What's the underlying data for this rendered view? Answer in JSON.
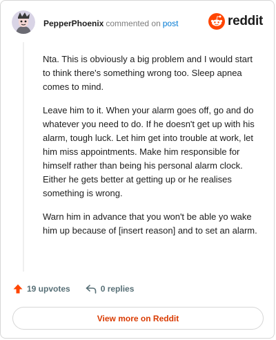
{
  "comment": {
    "author": "PepperPhoenix",
    "verb": "commented on",
    "post_link": "post",
    "paragraphs": [
      "Nta. This is obviously a big problem and I would start to think there's something wrong too. Sleep apnea comes to mind.",
      "Leave him to it. When your alarm goes off, go and do whatever you need to do. If he doesn't get up with his alarm, tough luck. Let him get into trouble at work, let him miss appointments. Make him responsible for himself rather than being his personal alarm clock. Either he gets better at getting up or he realises something is wrong.",
      "Warn him in advance that you won't be able yo wake him up because of [insert reason] and to set an alarm."
    ],
    "upvotes": "19 upvotes",
    "replies": "0 replies"
  },
  "brand": {
    "wordmark": "reddit",
    "icon": "reddit-alien-logo",
    "color": "#ff4500"
  },
  "footer": {
    "view_more": "View more on Reddit"
  },
  "colors": {
    "accent_orange": "#ff4500",
    "link_blue": "#0079d3",
    "view_more_text": "#d93a00"
  }
}
